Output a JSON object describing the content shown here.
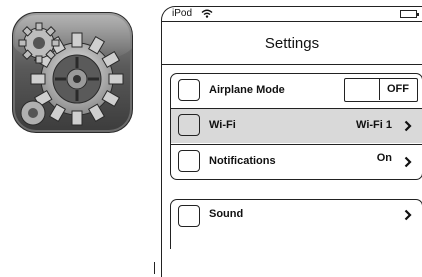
{
  "app_icon": {
    "name": "settings-app-icon"
  },
  "status_bar": {
    "carrier": "iPod",
    "icons": [
      "wifi-icon",
      "battery-icon"
    ]
  },
  "nav": {
    "title": "Settings"
  },
  "group1": {
    "rows": [
      {
        "label": "Airplane Mode",
        "toggle_text": "OFF"
      },
      {
        "label": "Wi-Fi",
        "value": "Wi-Fi 1",
        "highlighted": true
      },
      {
        "label": "Notifications",
        "value": "On"
      }
    ]
  },
  "group2": {
    "rows": [
      {
        "label": "Sound"
      }
    ]
  },
  "colors": {
    "highlight": "#d9d9d9",
    "outline": "#222222"
  }
}
